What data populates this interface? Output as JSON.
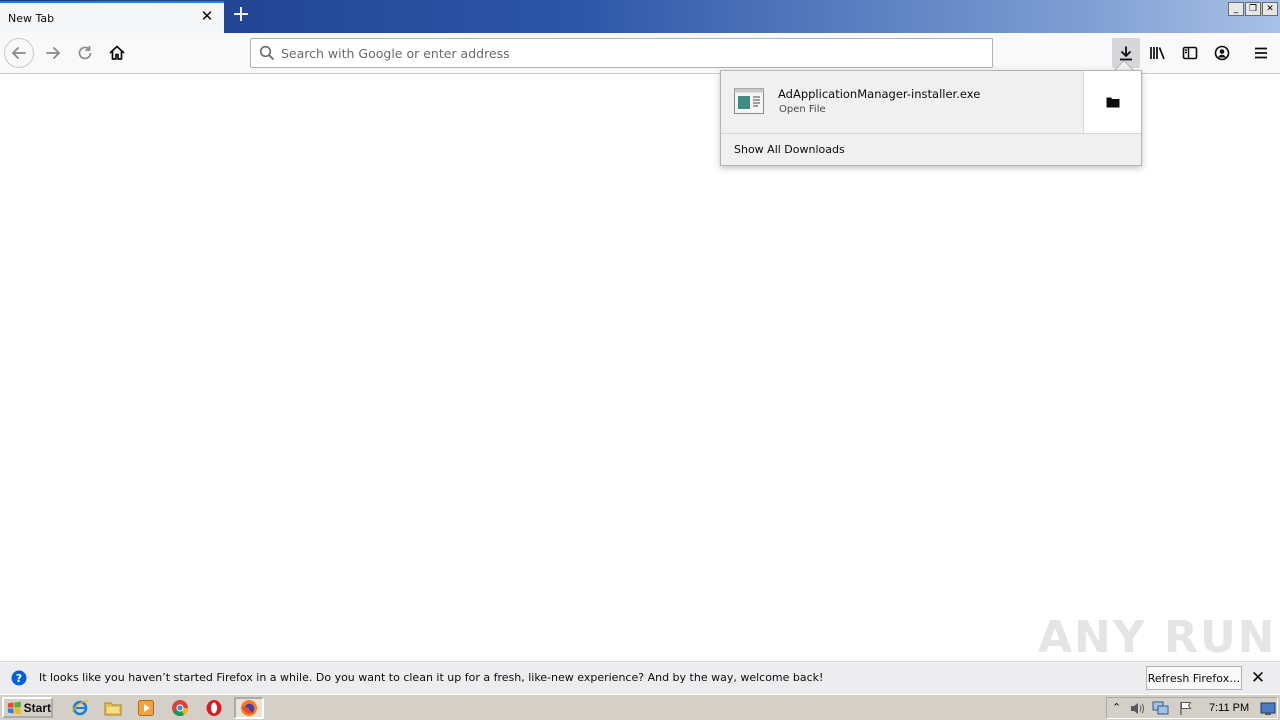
{
  "tab": {
    "title": "New Tab"
  },
  "navbar": {
    "url_placeholder": "Search with Google or enter address"
  },
  "downloads": {
    "items": [
      {
        "filename": "AdApplicationManager-installer.exe",
        "status": "Open File"
      }
    ],
    "show_all_label": "Show All Downloads"
  },
  "notification": {
    "text": "It looks like you haven’t started Firefox in a while. Do you want to clean it up for a fresh, like-new experience? And by the way, welcome back!",
    "refresh_label": "Refresh Firefox…"
  },
  "watermark": {
    "text": "ANY RUN"
  },
  "taskbar": {
    "start_label": "Start",
    "clock": "7:11 PM"
  },
  "colors": {
    "accent": "#0a84ff",
    "titlebar_start": "#1a3a86",
    "titlebar_end": "#a9c1e6"
  }
}
